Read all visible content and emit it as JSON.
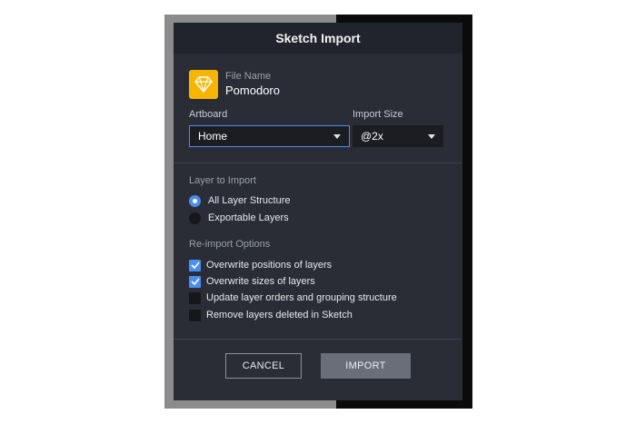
{
  "dialog": {
    "title": "Sketch Import",
    "file_label": "File Name",
    "file_name": "Pomodoro",
    "artboard_label": "Artboard",
    "artboard_value": "Home",
    "import_size_label": "Import Size",
    "import_size_value": "@2x",
    "layer_section_title": "Layer to Import",
    "layer_options": [
      {
        "label": "All Layer Structure",
        "selected": true
      },
      {
        "label": "Exportable Layers",
        "selected": false
      }
    ],
    "reimport_section_title": "Re-import Options",
    "reimport_options": [
      {
        "label": "Overwrite positions of layers",
        "checked": true
      },
      {
        "label": "Overwrite sizes of layers",
        "checked": true
      },
      {
        "label": "Update layer orders and grouping structure",
        "checked": false
      },
      {
        "label": "Remove layers deleted in Sketch",
        "checked": false
      }
    ],
    "cancel_label": "CANCEL",
    "import_label": "IMPORT"
  },
  "colors": {
    "dialog_bg": "#2a2d36",
    "title_bg": "#21242b",
    "accent": "#4a8ff0",
    "sketch_icon": "#f7b500"
  },
  "icons": [
    "sketch-logo-icon",
    "chevron-down-icon",
    "checkmark-icon"
  ]
}
